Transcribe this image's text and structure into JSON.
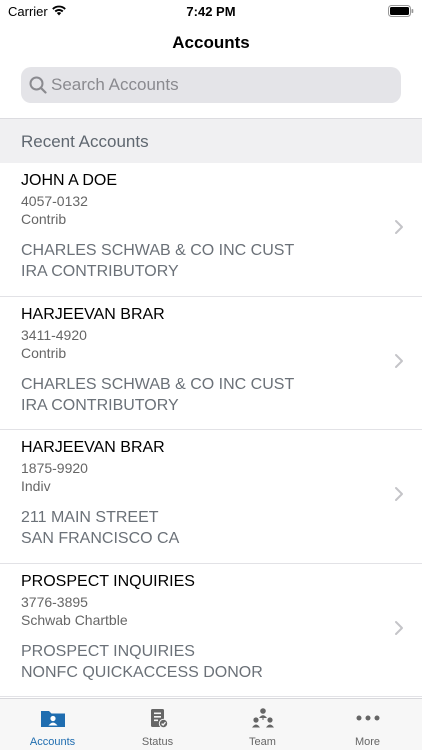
{
  "status_bar": {
    "carrier": "Carrier",
    "time": "7:42 PM"
  },
  "nav": {
    "title": "Accounts"
  },
  "search": {
    "placeholder": "Search Accounts",
    "value": ""
  },
  "section": {
    "title": "Recent Accounts"
  },
  "accounts": [
    {
      "name": "JOHN A DOE",
      "number": "4057-0132",
      "type": "Contrib",
      "line1": "CHARLES SCHWAB & CO INC CUST",
      "line2": "IRA CONTRIBUTORY"
    },
    {
      "name": "HARJEEVAN BRAR",
      "number": "3411-4920",
      "type": "Contrib",
      "line1": "CHARLES SCHWAB & CO INC CUST",
      "line2": "IRA CONTRIBUTORY"
    },
    {
      "name": "HARJEEVAN BRAR",
      "number": "1875-9920",
      "type": "Indiv",
      "line1": "211 MAIN STREET",
      "line2": "SAN FRANCISCO CA"
    },
    {
      "name": "PROSPECT INQUIRIES",
      "number": "3776-3895",
      "type": "Schwab Chartble",
      "line1": "PROSPECT INQUIRIES",
      "line2": "NONFC QUICKACCESS DONOR"
    }
  ],
  "tabs": [
    {
      "label": "Accounts",
      "icon": "folder-person-icon",
      "active": true
    },
    {
      "label": "Status",
      "icon": "clipboard-check-icon",
      "active": false
    },
    {
      "label": "Team",
      "icon": "team-icon",
      "active": false
    },
    {
      "label": "More",
      "icon": "more-dots-icon",
      "active": false
    }
  ],
  "colors": {
    "accent": "#1f6db0",
    "secondary_text": "#6b7178",
    "search_bg": "#e4e4e8",
    "header_bg": "#f0f0f2"
  }
}
